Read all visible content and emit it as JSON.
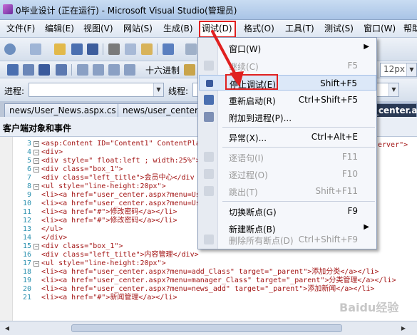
{
  "window": {
    "title": "0毕业设计 (正在运行) - Microsoft Visual Studio(管理员)"
  },
  "menubar": [
    {
      "label": "文件(F)"
    },
    {
      "label": "编辑(E)"
    },
    {
      "label": "视图(V)"
    },
    {
      "label": "网站(S)"
    },
    {
      "label": "生成(B)"
    },
    {
      "label": "调试(D)"
    },
    {
      "label": "格式(O)"
    },
    {
      "label": "工具(T)"
    },
    {
      "label": "测试(S)"
    },
    {
      "label": "窗口(W)"
    },
    {
      "label": "帮助"
    }
  ],
  "toolbar2": {
    "hex_label": "十六进制",
    "font_size": "12px"
  },
  "toolbar3": {
    "process_label": "进程:",
    "thread_label": "线程:"
  },
  "tabs": [
    {
      "label": "news/User_News.aspx.cs"
    },
    {
      "label": "news/user_center."
    },
    {
      "label": "r_center.a"
    }
  ],
  "panel": {
    "label": "客户端对象和事件"
  },
  "debug_menu": [
    {
      "label": "窗口(W)",
      "shortcut": "",
      "submenu": true,
      "disabled": false
    },
    {
      "label": "继续(C)",
      "shortcut": "F5",
      "disabled": true
    },
    {
      "label": "停止调试(E)",
      "shortcut": "Shift+F5",
      "disabled": false,
      "highlight": true
    },
    {
      "label": "重新启动(R)",
      "shortcut": "Ctrl+Shift+F5",
      "disabled": false
    },
    {
      "label": "附加到进程(P)...",
      "shortcut": "",
      "disabled": false
    },
    {
      "label": "异常(X)...",
      "shortcut": "Ctrl+Alt+E",
      "disabled": false
    },
    {
      "label": "逐语句(I)",
      "shortcut": "F11",
      "disabled": true
    },
    {
      "label": "逐过程(O)",
      "shortcut": "F10",
      "disabled": true
    },
    {
      "label": "跳出(T)",
      "shortcut": "Shift+F11",
      "disabled": true
    },
    {
      "label": "切换断点(G)",
      "shortcut": "F9",
      "disabled": false
    },
    {
      "label": "新建断点(B)",
      "shortcut": "",
      "submenu": true,
      "disabled": false
    },
    {
      "label": "删除所有断点(D)",
      "shortcut": "Ctrl+Shift+F9",
      "disabled": true
    }
  ],
  "code": [
    {
      "n": "3",
      "t": "<asp:Content ID=\"Content1\" ContentPla"
    },
    {
      "n": "4",
      "t": "<div>"
    },
    {
      "n": "5",
      "t": "<div style=\" float:left ; width:25%\">"
    },
    {
      "n": "6",
      "t": "<div class=\"box_1\">"
    },
    {
      "n": "7",
      "t": "<div class=\"left_title\">会员中心</div"
    },
    {
      "n": "8",
      "t": "<ul style=\"line-height:20px\">"
    },
    {
      "n": "9",
      "t": "<li><a href=\"user_center.aspx?menu=Us"
    },
    {
      "n": "10",
      "t": "<li><a href=\"user_center.aspx?menu=Us"
    },
    {
      "n": "11",
      "t": "<li><a href=\"#\">修改密码</a></li>"
    },
    {
      "n": "12",
      "t": "<li><a href=\"#\">修改密码</a></li>"
    },
    {
      "n": "13",
      "t": "</ul>"
    },
    {
      "n": "14",
      "t": "</div>"
    },
    {
      "n": "15",
      "t": "<div class=\"box_1\">"
    },
    {
      "n": "16",
      "t": "<div class=\"left_title\">内容管理</div>"
    },
    {
      "n": "17",
      "t": "<ul style=\"line-height:20px\">"
    },
    {
      "n": "18",
      "t": "<li><a href=\"user_center.aspx?menu=add_Class\" target=\"_parent\">添加分类</a></li>"
    },
    {
      "n": "19",
      "t": "<li><a href=\"user_center.aspx?menu=manager_Class\" target=\"_parent\">分类管理</a></li>"
    },
    {
      "n": "20",
      "t": "<li><a href=\"user_center.aspx?menu=news_add\" target=\"_parent\">添加新闻</a></li>"
    },
    {
      "n": "21",
      "t": "<li><a href=\"#\">新闻管理</a></li>"
    }
  ],
  "code_tail": "erver\">",
  "watermark": "Baidu经验"
}
